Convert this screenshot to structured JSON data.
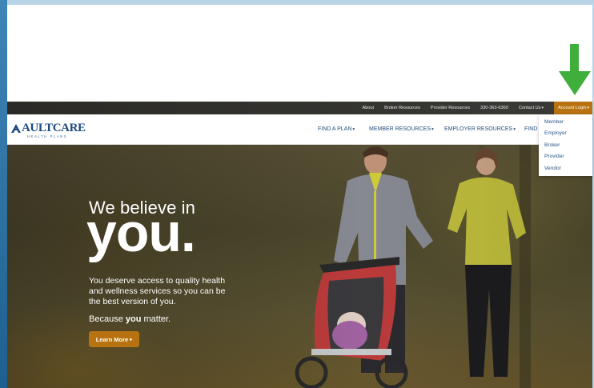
{
  "utility_bar": {
    "links": [
      "About",
      "Broker Resources",
      "Provider Resources",
      "330-363-6360"
    ],
    "contact_label": "Contact Us",
    "account_login_label": "Account Login"
  },
  "logo": {
    "name": "AULTCARE",
    "tagline": "HEALTH PLANS"
  },
  "main_nav": {
    "items": [
      "FIND A PLAN",
      "MEMBER RESOURCES",
      "EMPLOYER RESOURCES",
      "FIND"
    ]
  },
  "account_dropdown": {
    "items": [
      "Member",
      "Employer",
      "Broker",
      "Provider",
      "Vendor"
    ]
  },
  "hero": {
    "headline_line1": "We believe in",
    "headline_line2": "you.",
    "body": "You deserve access to quality health and wellness services so you can be the best version of you.",
    "tagline_prefix": "Because ",
    "tagline_emphasis": "you",
    "tagline_suffix": " matter.",
    "cta_label": "Learn More"
  },
  "icons": {
    "caret": "caret-down-icon",
    "arrow": "green-down-arrow-icon"
  },
  "colors": {
    "accent_gold": "#b8720f",
    "nav_blue": "#23507f",
    "annotation_green": "#3fae3a"
  }
}
